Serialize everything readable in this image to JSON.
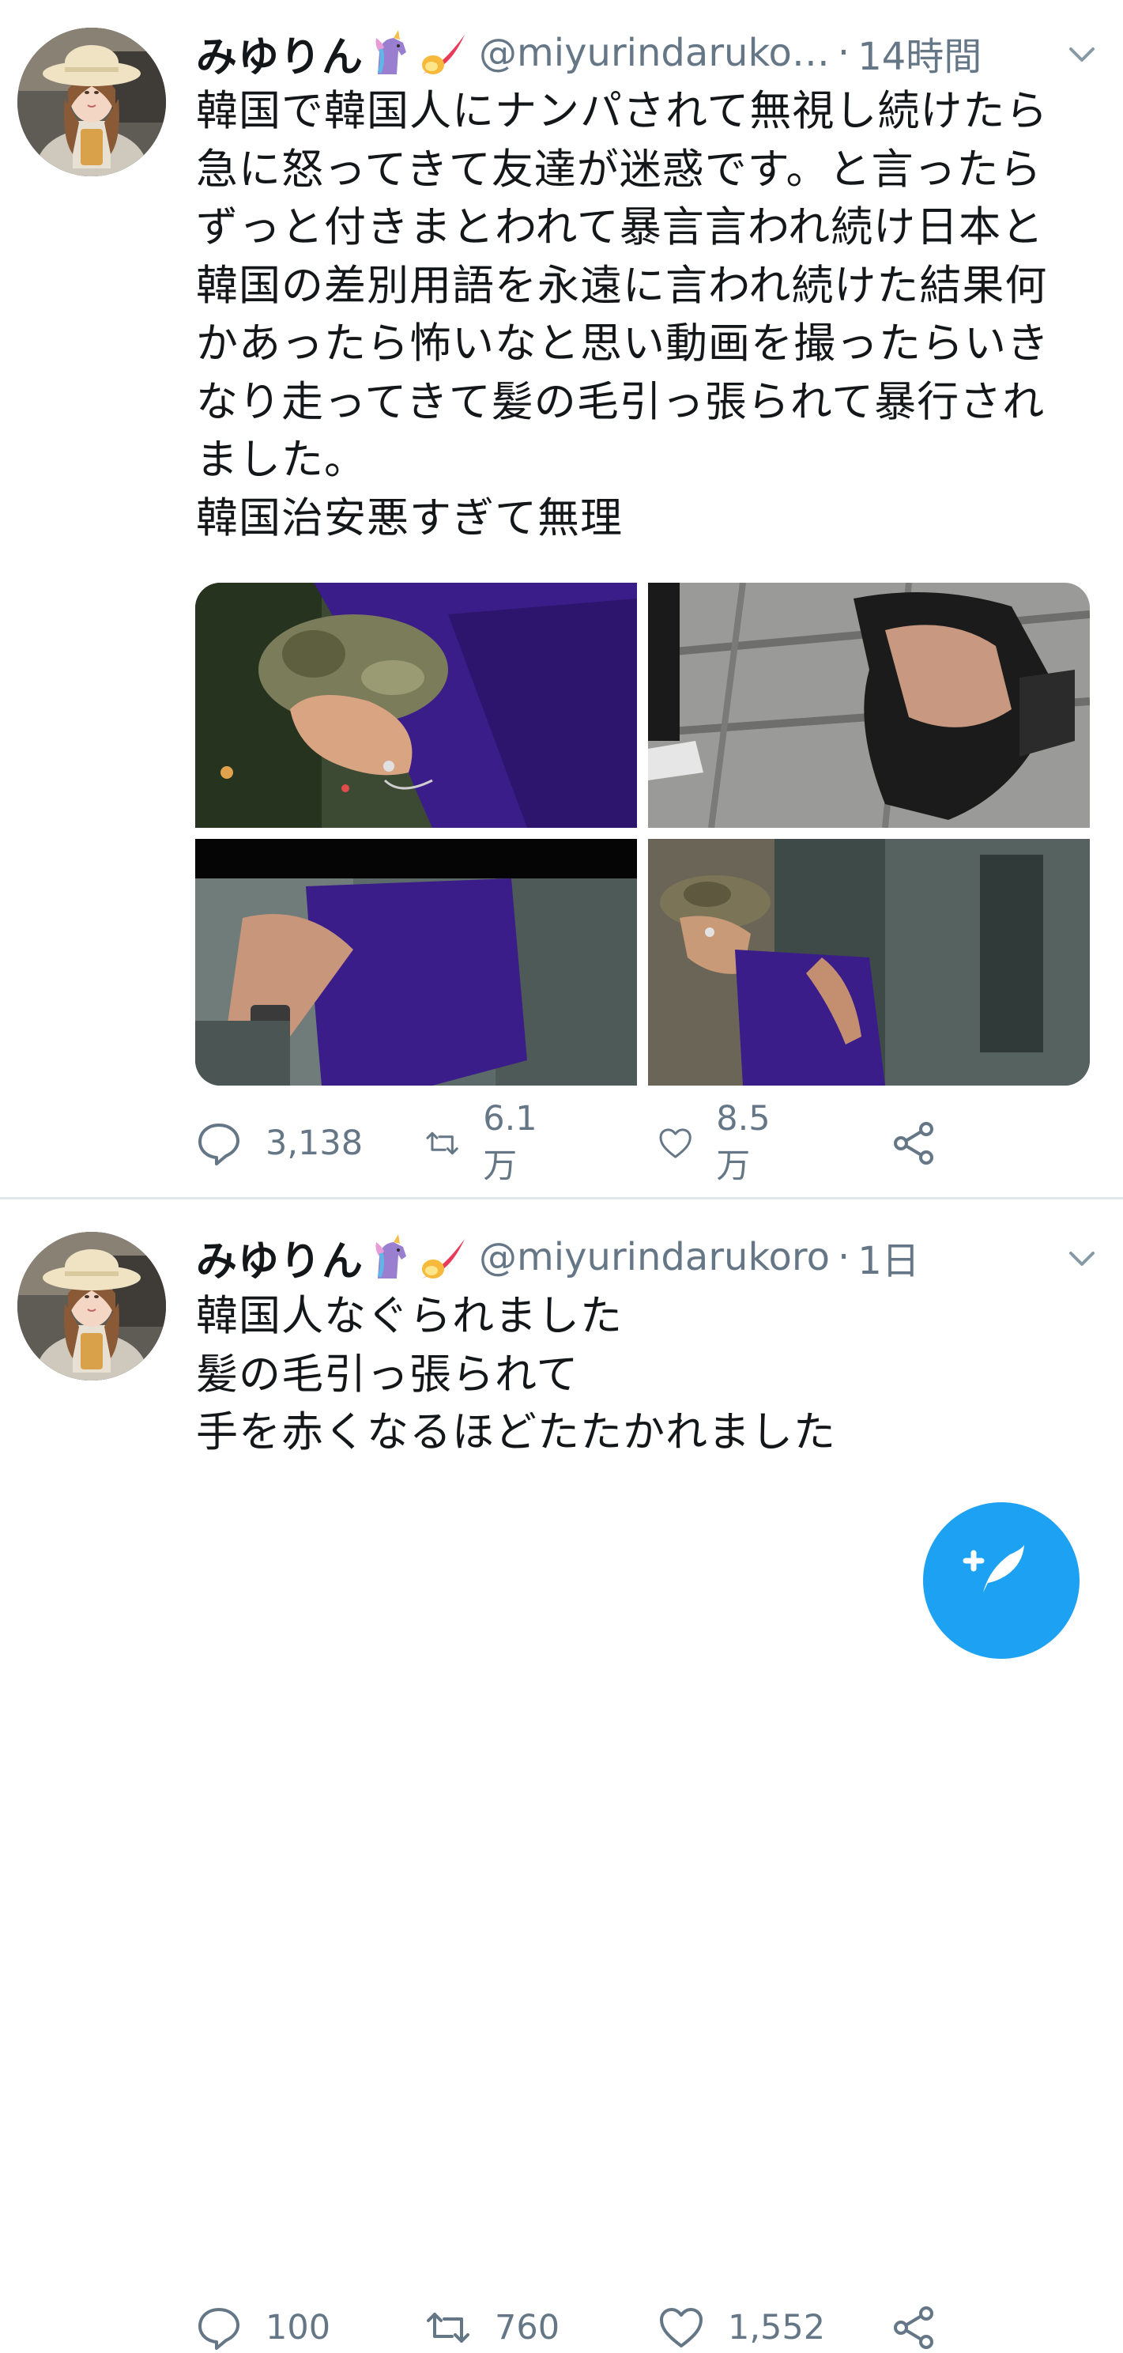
{
  "tweets": [
    {
      "display_name": "みゆりん",
      "emojis": [
        "unicorn-emoji",
        "comet-emoji"
      ],
      "handle": "@miyurindaruko…",
      "separator": "·",
      "time": "14時間",
      "text": "韓国で韓国人にナンパされて無視し続けたら\n急に怒ってきて友達が迷惑です。と言ったら\nずっと付きまとわれて暴言言われ続け日本と\n韓国の差別用語を永遠に言われ続けた結果何\nかあったら怖いなと思い動画を撮ったらいき\nなり走ってきて髪の毛引っ張られて暴行され\nました。\n韓国治安悪すぎて無理",
      "media_count": 4,
      "stats": {
        "replies": "3,138",
        "retweets": "6.1万",
        "likes": "8.5万"
      }
    },
    {
      "display_name": "みゆりん",
      "emojis": [
        "unicorn-emoji",
        "comet-emoji"
      ],
      "handle": "@miyurindarukoro",
      "separator": "·",
      "time": "1日",
      "text": "韓国人なぐられました\n髪の毛引っ張られて\n手を赤くなるほどたたかれました",
      "stats": {
        "replies": "100",
        "retweets": "760",
        "likes": "1,552"
      }
    }
  ],
  "icons": {
    "reply": "speech-bubble-icon",
    "retweet": "retweet-arrows-icon",
    "like": "heart-icon",
    "share": "share-nodes-icon",
    "menu": "chevron-down-icon",
    "compose": "compose-feather-icon"
  },
  "colors": {
    "text": "#14171a",
    "secondary": "#657786",
    "divider": "#e1e8ed",
    "accent": "#1da1f2",
    "shirt_purple": "#3b1d8a"
  }
}
